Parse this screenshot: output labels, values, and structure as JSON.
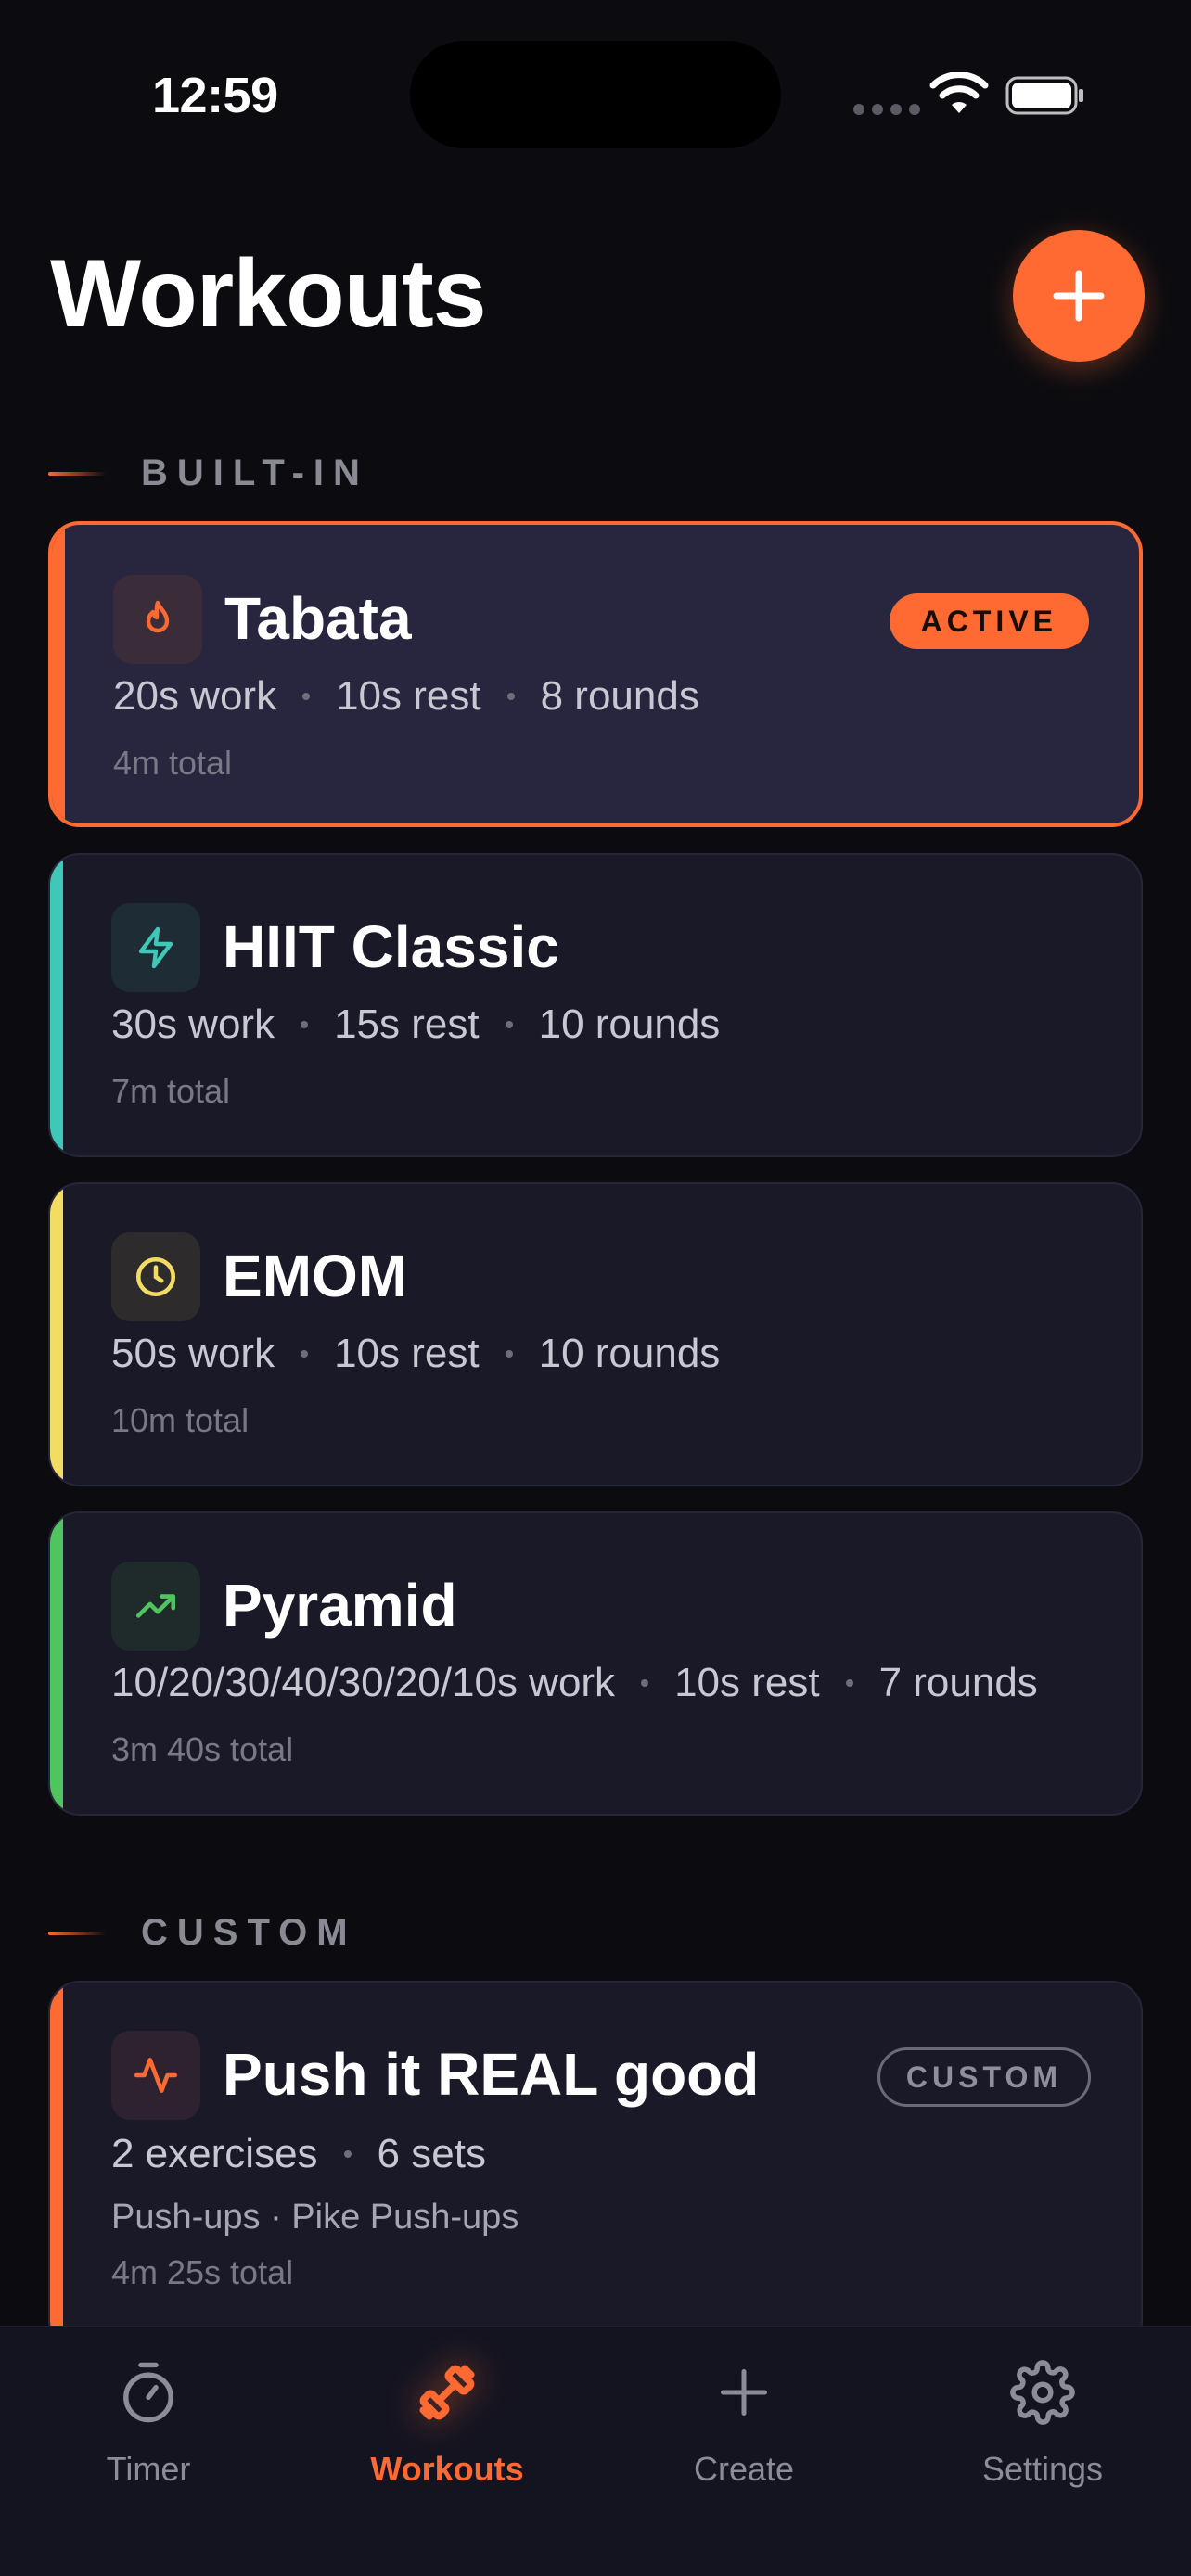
{
  "status_bar": {
    "time": "12:59"
  },
  "header": {
    "title": "Workouts"
  },
  "sections": {
    "builtin_label": "BUILT-IN",
    "custom_label": "CUSTOM"
  },
  "colors": {
    "accent": "#ff6a33",
    "tabata": "#ff6a33",
    "hiit": "#3fc7b8",
    "emom": "#f2dc62",
    "pyramid": "#4fc45f",
    "custom": "#ff6a33"
  },
  "workouts": [
    {
      "name": "Tabata",
      "icon": "flame-icon",
      "badge": "ACTIVE",
      "meta": [
        "20s work",
        "10s rest",
        "8 rounds"
      ],
      "total": "4m total"
    },
    {
      "name": "HIIT Classic",
      "icon": "lightning-icon",
      "meta": [
        "30s work",
        "15s rest",
        "10 rounds"
      ],
      "total": "7m total"
    },
    {
      "name": "EMOM",
      "icon": "clock-icon",
      "meta": [
        "50s work",
        "10s rest",
        "10 rounds"
      ],
      "total": "10m total"
    },
    {
      "name": "Pyramid",
      "icon": "trending-up-icon",
      "meta": [
        "10/20/30/40/30/20/10s work",
        "10s rest",
        "7 rounds"
      ],
      "total": "3m 40s total"
    }
  ],
  "custom_workouts": [
    {
      "name": "Push it REAL good",
      "icon": "activity-icon",
      "badge": "CUSTOM",
      "meta": [
        "2 exercises",
        "6 sets"
      ],
      "exercises": "Push-ups · Pike Push-ups",
      "total": "4m 25s total"
    }
  ],
  "tabs": [
    {
      "label": "Timer",
      "icon": "stopwatch-icon",
      "active": false
    },
    {
      "label": "Workouts",
      "icon": "dumbbell-icon",
      "active": true
    },
    {
      "label": "Create",
      "icon": "plus-icon",
      "active": false
    },
    {
      "label": "Settings",
      "icon": "gear-icon",
      "active": false
    }
  ]
}
